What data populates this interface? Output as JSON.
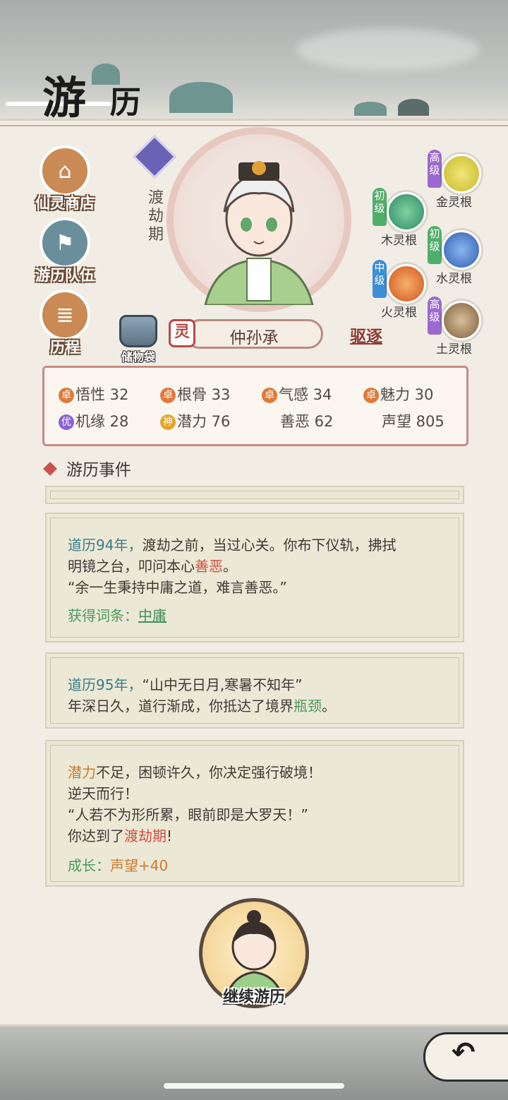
{
  "header": {
    "title_main": "游",
    "title_sub": "历"
  },
  "menu": [
    {
      "label": "仙灵商店",
      "icon": "shop-icon",
      "color": "#c98a55"
    },
    {
      "label": "游历队伍",
      "icon": "team-flag-icon",
      "color": "#6b8e9c"
    },
    {
      "label": "历程",
      "icon": "scroll-icon",
      "color": "#c98a55"
    }
  ],
  "character": {
    "realm": "渡劫期",
    "name": "仲孙承",
    "spirit_tag": "灵",
    "expel_label": "驱逐",
    "bag_label": "储物袋"
  },
  "roots": [
    {
      "tier": "高级",
      "label": "金灵根",
      "tier_color": "#9b6ad0",
      "orb_color": "#d9cb3a"
    },
    {
      "tier": "初级",
      "label": "木灵根",
      "tier_color": "#4fae6a",
      "orb_color": "#3fa078"
    },
    {
      "tier": "初级",
      "label": "水灵根",
      "tier_color": "#4fae6a",
      "orb_color": "#3f6fc4"
    },
    {
      "tier": "中级",
      "label": "火灵根",
      "tier_color": "#3b8fd6",
      "orb_color": "#e06a2e"
    },
    {
      "tier": "高级",
      "label": "土灵根",
      "tier_color": "#9b6ad0",
      "orb_color": "#9a7a55"
    }
  ],
  "stats": [
    {
      "tag": "卓",
      "tag_color": "#e07a3a",
      "label": "悟性 32"
    },
    {
      "tag": "卓",
      "tag_color": "#e07a3a",
      "label": "根骨 33"
    },
    {
      "tag": "卓",
      "tag_color": "#e07a3a",
      "label": "气感 34"
    },
    {
      "tag": "卓",
      "tag_color": "#e07a3a",
      "label": "魅力 30"
    },
    {
      "tag": "优",
      "tag_color": "#8a62d4",
      "label": "机缘 28"
    },
    {
      "tag": "神",
      "tag_color": "#e3a52c",
      "label": "潜力 76"
    },
    {
      "tag": "",
      "tag_color": "",
      "label": "善恶 62"
    },
    {
      "tag": "",
      "tag_color": "",
      "label": "声望 805"
    }
  ],
  "events_title": "游历事件",
  "events": {
    "e1": {
      "l1a": "道历94年，",
      "l1b": "渡劫之前，当过心关。你布下仪轨，拂拭",
      "l2a": "明镜之台，叩问本心",
      "l2b": "善恶",
      "l2c": "。",
      "l3": "“余一生秉持中庸之道，难言善恶。”",
      "l4a": "获得词条：",
      "l4b": "中庸"
    },
    "e2": {
      "l1a": "道历95年，",
      "l1b": "“山中无日月,寒暑不知年”",
      "l2a": "年深日久，道行渐成，你抵达了境界",
      "l2b": "瓶颈",
      "l2c": "。"
    },
    "e3": {
      "l1a": "潜力",
      "l1b": "不足，困顿许久，你决定强行破境！",
      "l2": "逆天而行！",
      "l3": "“人若不为形所累，眼前即是大罗天！”",
      "l4a": "你达到了",
      "l4b": "渡劫期",
      "l4c": "!",
      "l5a": "成长：",
      "l5b": "声望+40"
    }
  },
  "continue_label": "继续游历",
  "back_icon": "back-arrow-icon"
}
